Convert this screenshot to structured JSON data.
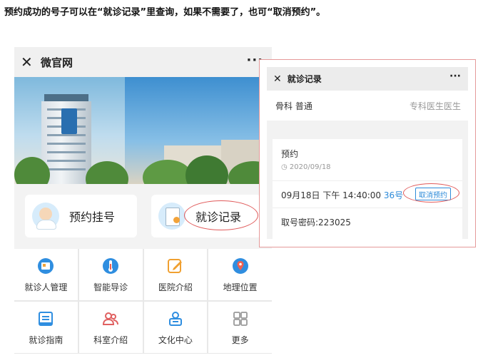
{
  "instruction": "预约成功的号子可以在“就诊记录”里查询，如果不需要了，也可“取消预约”。",
  "left_screen": {
    "title": "微官网",
    "close_icon": "close-icon",
    "more_icon": "more-icon",
    "quick_buttons": [
      {
        "label": "预约挂号",
        "icon": "doctor-avatar-icon"
      },
      {
        "label": "就诊记录",
        "icon": "record-document-icon"
      }
    ],
    "grid": [
      {
        "label": "就诊人管理",
        "icon": "patient-card-icon",
        "color": "#2f8ee0"
      },
      {
        "label": "智能导诊",
        "icon": "thermometer-icon",
        "color": "#2f8ee0"
      },
      {
        "label": "医院介绍",
        "icon": "edit-icon",
        "color": "#f0a030"
      },
      {
        "label": "地理位置",
        "icon": "location-pin-icon",
        "color": "#2f8ee0"
      },
      {
        "label": "就诊指南",
        "icon": "guide-book-icon",
        "color": "#2f8ee0"
      },
      {
        "label": "科室介绍",
        "icon": "people-icon",
        "color": "#e06060"
      },
      {
        "label": "文化中心",
        "icon": "culture-icon",
        "color": "#2f8ee0"
      },
      {
        "label": "更多",
        "icon": "grid-more-icon",
        "color": "#999999"
      }
    ]
  },
  "right_screen": {
    "title": "就诊记录",
    "department": "骨科 普通",
    "doctor": "专科医生医生",
    "status": "预约",
    "date": "2020/09/18",
    "appointment_time": "09月18日 下午 14:40:00",
    "number": "36号",
    "cancel_label": "取消预约",
    "code": "取号密码:223025"
  },
  "colors": {
    "accent_blue": "#2e8bd9",
    "highlight_red": "#e05a5a"
  }
}
